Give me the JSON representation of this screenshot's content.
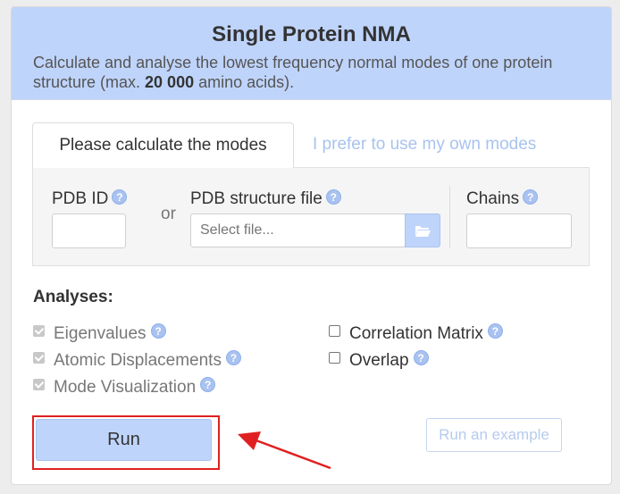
{
  "header": {
    "title": "Single Protein NMA",
    "description_pre": "Calculate and analyse the lowest frequency normal modes of one protein structure (max. ",
    "description_bold": "20 000",
    "description_post": " amino acids)."
  },
  "tabs": [
    {
      "label": "Please calculate the modes",
      "active": true
    },
    {
      "label": "I prefer to use my own modes",
      "active": false
    }
  ],
  "form": {
    "pdb_id": {
      "label": "PDB ID",
      "value": ""
    },
    "or_text": "or",
    "pdb_file": {
      "label": "PDB structure file",
      "placeholder": "Select file..."
    },
    "chains": {
      "label": "Chains",
      "value": ""
    },
    "help_glyph": "?"
  },
  "analyses": {
    "title": "Analyses:",
    "left": [
      {
        "label": "Eigenvalues",
        "checked": true,
        "disabled": true
      },
      {
        "label": "Atomic Displacements",
        "checked": true,
        "disabled": true
      },
      {
        "label": "Mode Visualization",
        "checked": true,
        "disabled": true
      }
    ],
    "right": [
      {
        "label": "Correlation Matrix",
        "checked": false,
        "disabled": false
      },
      {
        "label": "Overlap",
        "checked": false,
        "disabled": false
      }
    ]
  },
  "buttons": {
    "run": "Run",
    "example": "Run an example"
  },
  "colors": {
    "accent": "#bfd4fb",
    "highlight": "#e02020"
  }
}
